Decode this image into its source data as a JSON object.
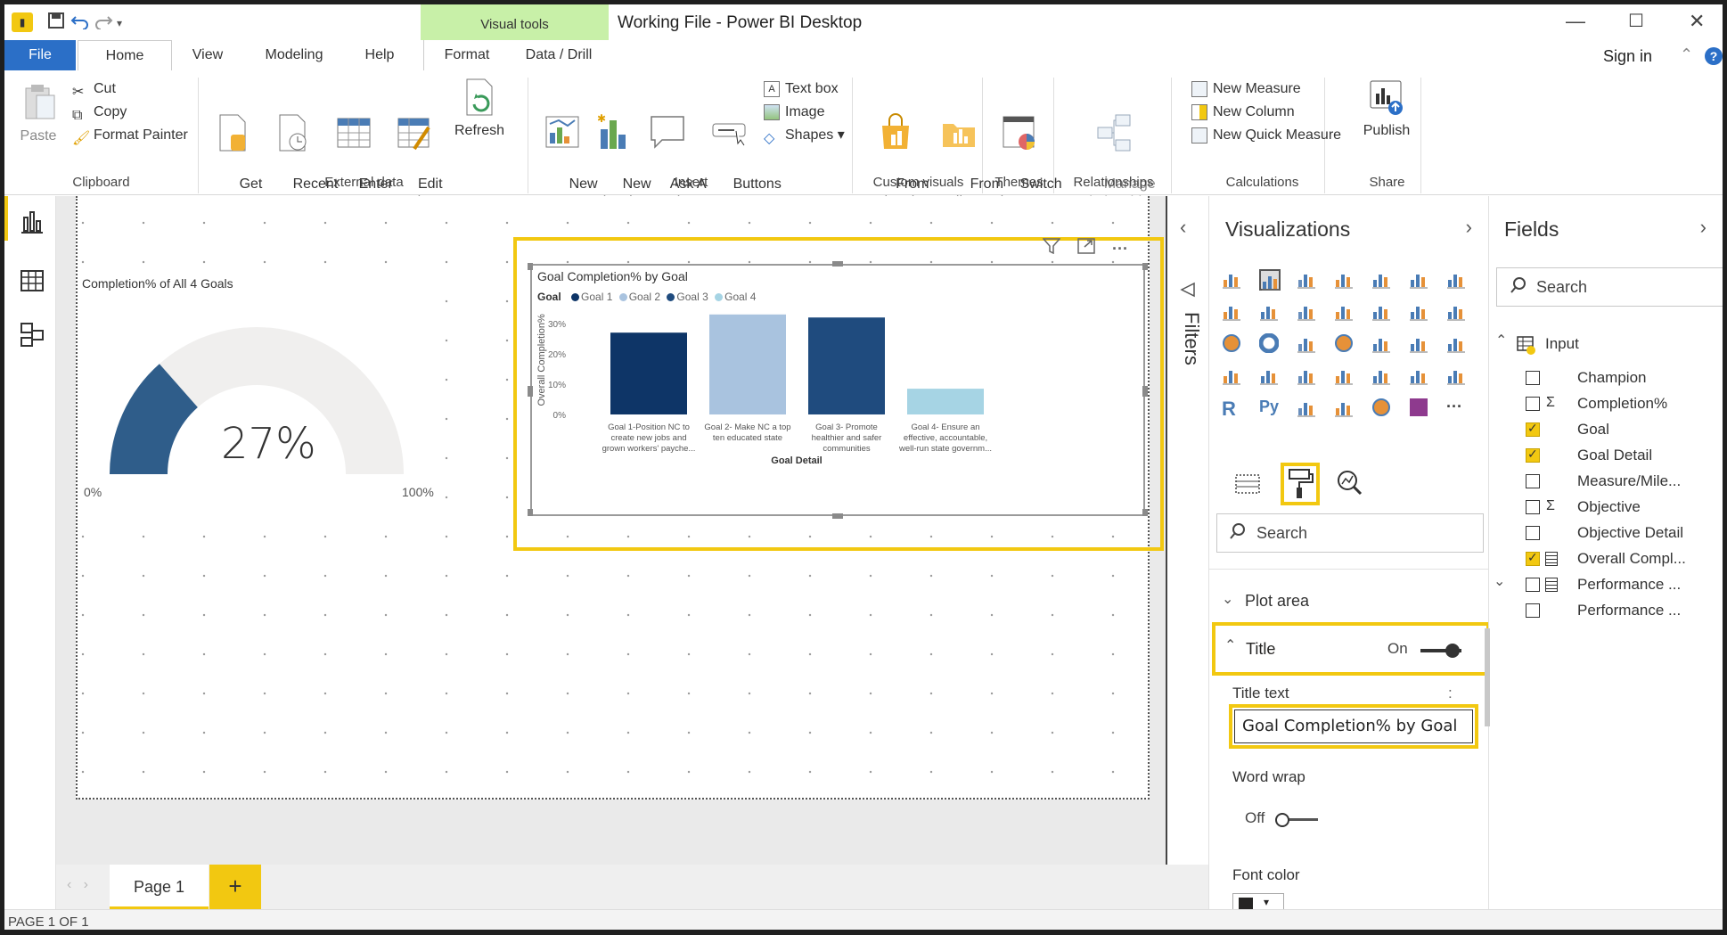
{
  "window": {
    "title": "Working File - Power BI Desktop",
    "contextual_tab_group": "Visual tools",
    "controls": {
      "minimize": "—",
      "maximize": "☐",
      "close": "✕"
    }
  },
  "tabs": [
    "File",
    "Home",
    "View",
    "Modeling",
    "Help",
    "Format",
    "Data / Drill"
  ],
  "account": {
    "sign_in": "Sign in",
    "help": "?"
  },
  "ribbon": {
    "clipboard": {
      "label": "Clipboard",
      "paste": "Paste",
      "cut": "Cut",
      "copy": "Copy",
      "format_painter": "Format Painter"
    },
    "external_data": {
      "label": "External data",
      "get_data": "Get\nData ▾",
      "recent_sources": "Recent\nSources ▾",
      "enter_data": "Enter\nData",
      "edit_queries": "Edit\nQueries ▾",
      "refresh": "Refresh"
    },
    "insert": {
      "label": "Insert",
      "new_page": "New\nPage ▾",
      "new_visual": "New\nVisual",
      "ask_question": "Ask A\nQuestion",
      "buttons": "Buttons\n▾",
      "text_box": "Text box",
      "image": "Image",
      "shapes": "Shapes ▾"
    },
    "custom_visuals": {
      "label": "Custom visuals",
      "from_marketplace": "From\nMarketplace",
      "from_file": "From\nFile"
    },
    "themes": {
      "label": "Themes",
      "switch_theme": "Switch\nTheme ▾"
    },
    "relationships": {
      "label": "Relationships",
      "manage": "Manage\nRelationships"
    },
    "calculations": {
      "label": "Calculations",
      "new_measure": "New Measure",
      "new_column": "New Column",
      "new_quick_measure": "New Quick Measure"
    },
    "share": {
      "label": "Share",
      "publish": "Publish"
    }
  },
  "gauge": {
    "title": "Completion% of All 4 Goals",
    "value": "27%",
    "min_label": "0%",
    "max_label": "100%",
    "fraction": 0.27,
    "fill_color": "#2f5d8a",
    "track_color": "#f0efee"
  },
  "chart_data": {
    "type": "bar",
    "title": "Goal Completion% by Goal",
    "legend_title": "Goal",
    "legend": [
      "Goal 1",
      "Goal 2",
      "Goal 3",
      "Goal 4"
    ],
    "categories": [
      [
        "Goal 1-Position NC to",
        "create new jobs and",
        "grown workers' payche..."
      ],
      [
        "Goal 2- Make NC a top",
        "ten educated state"
      ],
      [
        "Goal 3- Promote",
        "healthier and safer",
        "communities"
      ],
      [
        "Goal 4- Ensure an",
        "effective, accountable,",
        "well-run state governm..."
      ]
    ],
    "values": [
      27,
      33,
      32,
      8.5
    ],
    "colors": [
      "#0e3567",
      "#a9c3df",
      "#1f4b7e",
      "#a6d4e4"
    ],
    "xlabel": "Goal Detail",
    "ylabel": "Overall Completion%",
    "yticks": [
      "0%",
      "10%",
      "20%",
      "30%"
    ],
    "ylim": [
      0,
      35
    ],
    "grid": false,
    "legend_position": "top-left"
  },
  "filters_label": "Filters",
  "visualizations": {
    "title": "Visualizations",
    "search_placeholder": "Search",
    "plot_area": "Plot area",
    "title_section": "Title",
    "title_state": "On",
    "title_text_label": "Title text",
    "title_text_value": "Goal Completion% by Goal",
    "word_wrap_label": "Word wrap",
    "word_wrap_state": "Off",
    "font_color_label": "Font color",
    "extra_menu": ":",
    "more": "···",
    "r_label": "R",
    "py_label": "Py"
  },
  "fields": {
    "title": "Fields",
    "search_placeholder": "Search",
    "table": "Input",
    "items": [
      {
        "name": "Champion",
        "checked": false,
        "icon": ""
      },
      {
        "name": "Completion%",
        "checked": false,
        "icon": "Σ"
      },
      {
        "name": "Goal",
        "checked": true,
        "icon": ""
      },
      {
        "name": "Goal Detail",
        "checked": true,
        "icon": ""
      },
      {
        "name": "Measure/Mile...",
        "checked": false,
        "icon": ""
      },
      {
        "name": "Objective",
        "checked": false,
        "icon": "Σ"
      },
      {
        "name": "Objective Detail",
        "checked": false,
        "icon": ""
      },
      {
        "name": "Overall Compl...",
        "checked": true,
        "icon": "calc-icon"
      },
      {
        "name": "Performance ...",
        "checked": false,
        "icon": "hierarchy-icon"
      },
      {
        "name": "Performance ...",
        "checked": false,
        "icon": ""
      }
    ]
  },
  "pages": {
    "tab": "Page 1",
    "add": "+"
  },
  "status": "PAGE 1 OF 1"
}
